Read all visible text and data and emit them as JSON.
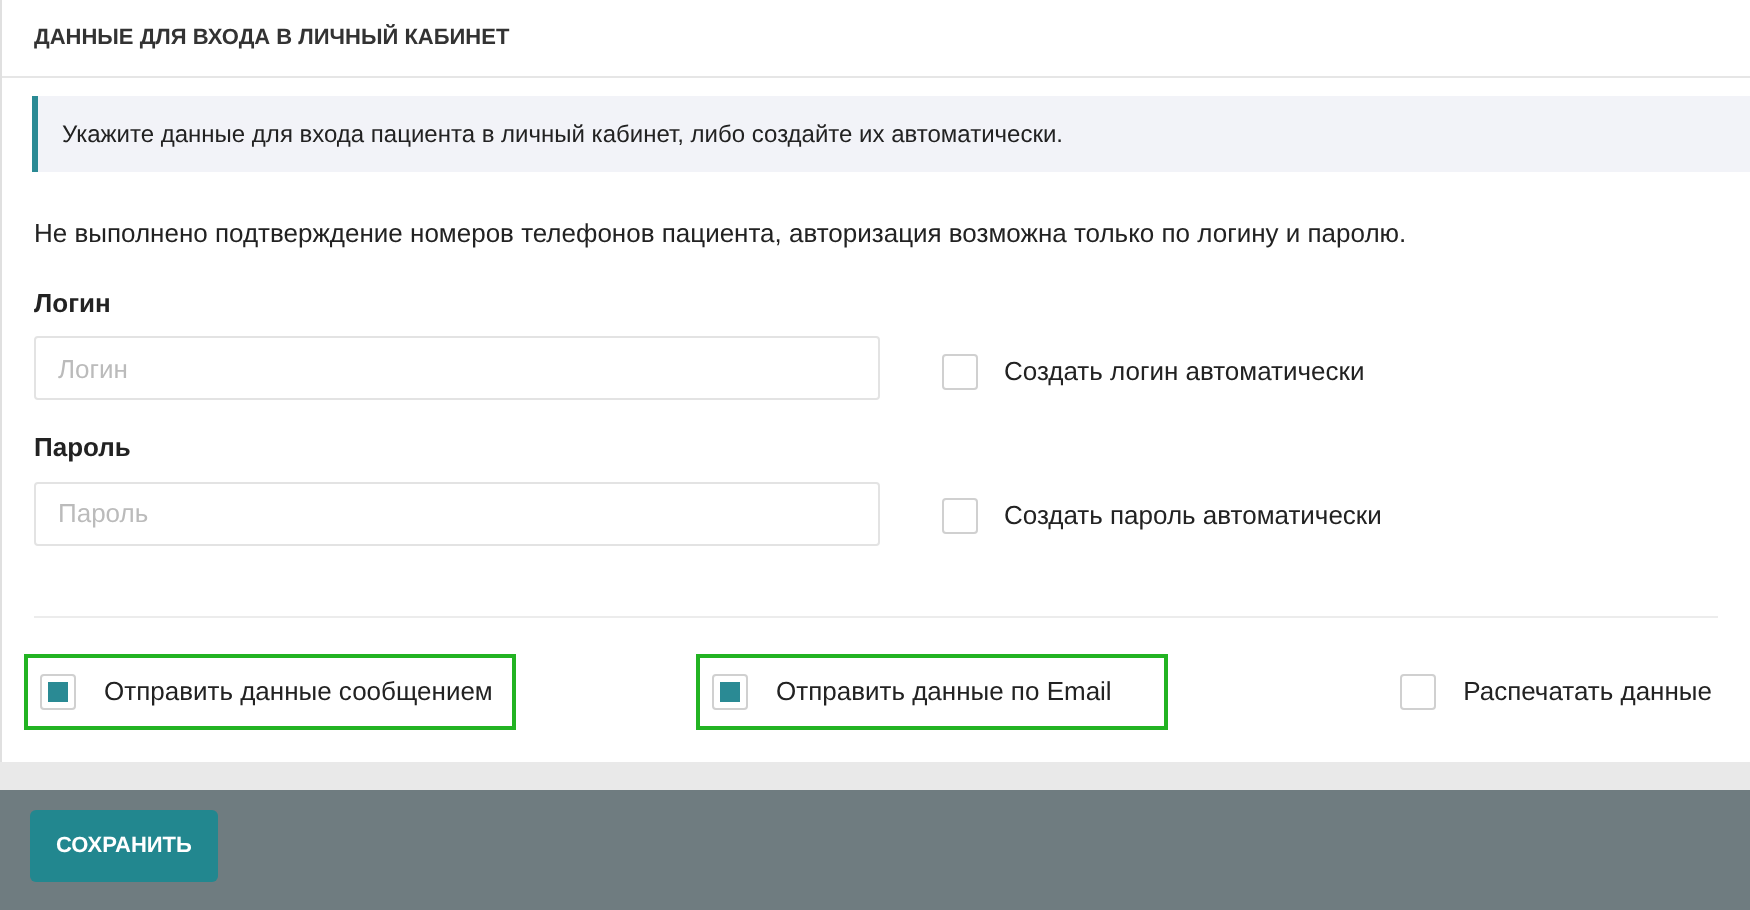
{
  "panel": {
    "title": "ДАННЫЕ ДЛЯ ВХОДА В ЛИЧНЫЙ КАБИНЕТ"
  },
  "info": "Укажите данные для входа пациента в личный кабинет, либо создайте их автоматически.",
  "warning": "Не выполнено подтверждение номеров телефонов пациента, авторизация возможна только по логину и паролю.",
  "fields": [
    {
      "label": "Логин",
      "placeholder": "Логин",
      "auto_label": "Создать логин автоматически",
      "checked": false
    },
    {
      "label": "Пароль",
      "placeholder": "Пароль",
      "auto_label": "Создать пароль автоматически",
      "checked": false
    }
  ],
  "options": [
    {
      "label": "Отправить данные сообщением",
      "checked": true,
      "highlighted": true
    },
    {
      "label": "Отправить данные по Email",
      "checked": true,
      "highlighted": true
    },
    {
      "label": "Распечатать данные",
      "checked": false,
      "highlighted": false
    }
  ],
  "save_button": "СОХРАНИТЬ"
}
